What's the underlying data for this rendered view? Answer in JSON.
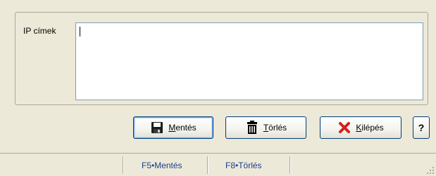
{
  "form": {
    "ip_label": "IP címek",
    "ip_value": ""
  },
  "buttons": {
    "save_label": "Mentés",
    "delete_label": "Törlés",
    "exit_label": "Kilépés",
    "help_label": "?"
  },
  "statusbar": {
    "shortcut_save": "F5•Mentés",
    "shortcut_delete": "F8•Törlés"
  },
  "icons": {
    "save": "floppy-disk-icon",
    "delete": "trash-can-icon",
    "exit": "red-x-icon"
  },
  "colors": {
    "window_bg": "#ece9d8",
    "button_border": "#003c74",
    "exit_icon": "#d42020",
    "status_text": "#1a3f8f"
  }
}
